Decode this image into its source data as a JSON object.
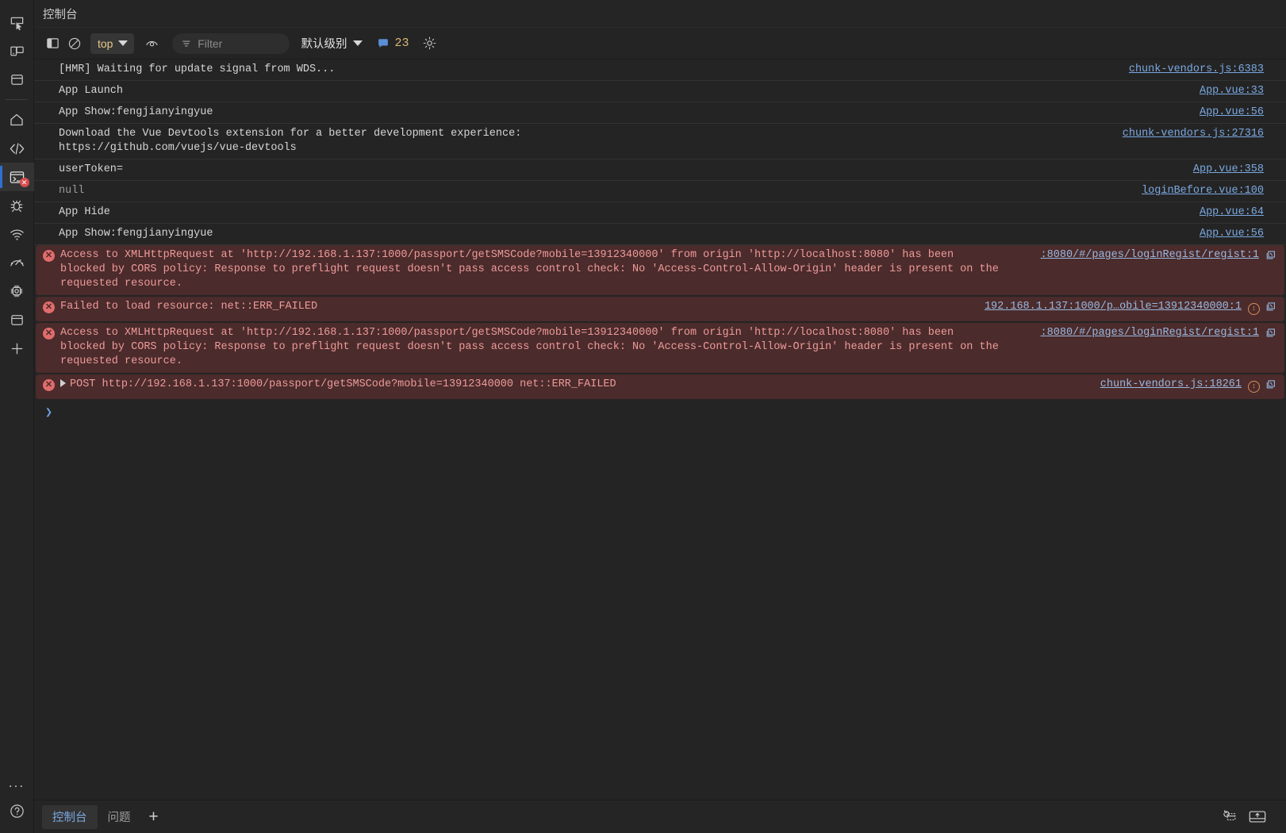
{
  "activity_bar": {
    "top_items": [
      {
        "name": "inspect-element-icon",
        "title": "Inspect"
      },
      {
        "name": "device-toolbar-icon",
        "title": "Device toolbar"
      },
      {
        "name": "panel-layout-icon",
        "title": "Layout"
      }
    ],
    "mid_items": [
      {
        "name": "home-icon",
        "title": "Home"
      },
      {
        "name": "code-icon",
        "title": "Sources"
      },
      {
        "name": "console-icon",
        "title": "Console",
        "active": true,
        "badge": "x"
      },
      {
        "name": "bug-icon",
        "title": "Debugger"
      },
      {
        "name": "network-wifi-icon",
        "title": "Network"
      },
      {
        "name": "performance-gauge-icon",
        "title": "Performance"
      },
      {
        "name": "chip-memory-icon",
        "title": "Memory"
      },
      {
        "name": "application-window-icon",
        "title": "Application"
      },
      {
        "name": "plus-icon",
        "title": "More panels"
      }
    ],
    "bottom_items": [
      {
        "name": "more-options-icon",
        "label": "..."
      },
      {
        "name": "help-icon",
        "label": "?"
      }
    ]
  },
  "panel": {
    "title": "控制台"
  },
  "toolbar": {
    "clear_console_label": "",
    "no_entry_label": "",
    "context": {
      "value": "top",
      "name": "execution-context-select"
    },
    "eye_label": "",
    "filter": {
      "placeholder": "Filter",
      "value": ""
    },
    "level": {
      "value": "默认级别"
    },
    "message_count": "23",
    "settings_label": ""
  },
  "console": {
    "entries": [
      {
        "type": "log",
        "parts": [
          {
            "t": "text",
            "v": "[HMR] Waiting for update signal from WDS..."
          }
        ],
        "source": "chunk-vendors.js:6383"
      },
      {
        "type": "log",
        "parts": [
          {
            "t": "text",
            "v": "App Launch"
          }
        ],
        "source": "App.vue:33"
      },
      {
        "type": "log",
        "parts": [
          {
            "t": "text",
            "v": "App Show:fengjianyingyue"
          }
        ],
        "source": "App.vue:56"
      },
      {
        "type": "log",
        "parts": [
          {
            "t": "text",
            "v": "Download the Vue Devtools extension for a better development experience:\n"
          },
          {
            "t": "link",
            "v": "https://github.com/vuejs/vue-devtools"
          }
        ],
        "source": "chunk-vendors.js:27316"
      },
      {
        "type": "log",
        "parts": [
          {
            "t": "text",
            "v": "userToken="
          }
        ],
        "source": "App.vue:358"
      },
      {
        "type": "log-dim",
        "parts": [
          {
            "t": "text",
            "v": "null"
          }
        ],
        "source": "loginBefore.vue:100"
      },
      {
        "type": "log",
        "parts": [
          {
            "t": "text",
            "v": "App Hide"
          }
        ],
        "source": "App.vue:64"
      },
      {
        "type": "log",
        "parts": [
          {
            "t": "text",
            "v": "App Show:fengjianyingyue"
          }
        ],
        "source": "App.vue:56"
      },
      {
        "type": "error",
        "parts": [
          {
            "t": "text",
            "v": "Access to XMLHttpRequest at '"
          },
          {
            "t": "link",
            "v": "http://192.168.1.137:1000/passport/getSMSCode?mobile=13912340000"
          },
          {
            "t": "text",
            "v": "' from origin '"
          },
          {
            "t": "link",
            "v": "http://localhost:8080"
          },
          {
            "t": "text",
            "v": "' has been\nblocked by CORS policy: Response to preflight request doesn't pass access control check: No 'Access-Control-Allow-Origin' header is present on the requested resource."
          }
        ],
        "source": ":8080/#/pages/loginRegist/regist:1",
        "trail": [
          "stack-icon"
        ]
      },
      {
        "type": "error",
        "parts": [
          {
            "t": "text",
            "v": "Failed to load resource: net::ERR_FAILED"
          }
        ],
        "source": "192.168.1.137:1000/p…obile=13912340000:1",
        "trail": [
          "circle-arrow-icon",
          "stack-icon"
        ]
      },
      {
        "type": "error",
        "parts": [
          {
            "t": "text",
            "v": "Access to XMLHttpRequest at '"
          },
          {
            "t": "link",
            "v": "http://192.168.1.137:1000/passport/getSMSCode?mobile=13912340000"
          },
          {
            "t": "text",
            "v": "' from origin '"
          },
          {
            "t": "link",
            "v": "http://localhost:8080"
          },
          {
            "t": "text",
            "v": "' has been\nblocked by CORS policy: Response to preflight request doesn't pass access control check: No 'Access-Control-Allow-Origin' header is present on the requested resource."
          }
        ],
        "source": ":8080/#/pages/loginRegist/regist:1",
        "trail": [
          "stack-icon"
        ]
      },
      {
        "type": "error-expandable",
        "parts": [
          {
            "t": "text",
            "v": "POST "
          },
          {
            "t": "link",
            "v": "http://192.168.1.137:1000/passport/getSMSCode?mobile=13912340000"
          },
          {
            "t": "text",
            "v": " net::ERR_FAILED"
          }
        ],
        "source": "chunk-vendors.js:18261",
        "trail": [
          "circle-arrow-icon",
          "stack-icon"
        ]
      }
    ],
    "prompt_symbol": "❯"
  },
  "bottom_bar": {
    "tabs": [
      {
        "label": "控制台",
        "active": true,
        "name": "bottom-tab-console"
      },
      {
        "label": "问题",
        "active": false,
        "name": "bottom-tab-issues"
      }
    ],
    "add_label": "+",
    "right_icons": [
      {
        "name": "refresh-device-icon"
      },
      {
        "name": "dock-panel-icon"
      }
    ]
  },
  "colors": {
    "background": "#242424",
    "chrome": "#252526",
    "error_bg": "#4b2b2b",
    "error_text": "#ef9a9a",
    "link": "#7aa8e0",
    "accent": "#2f6fd0",
    "context_label": "#e8c88a"
  }
}
